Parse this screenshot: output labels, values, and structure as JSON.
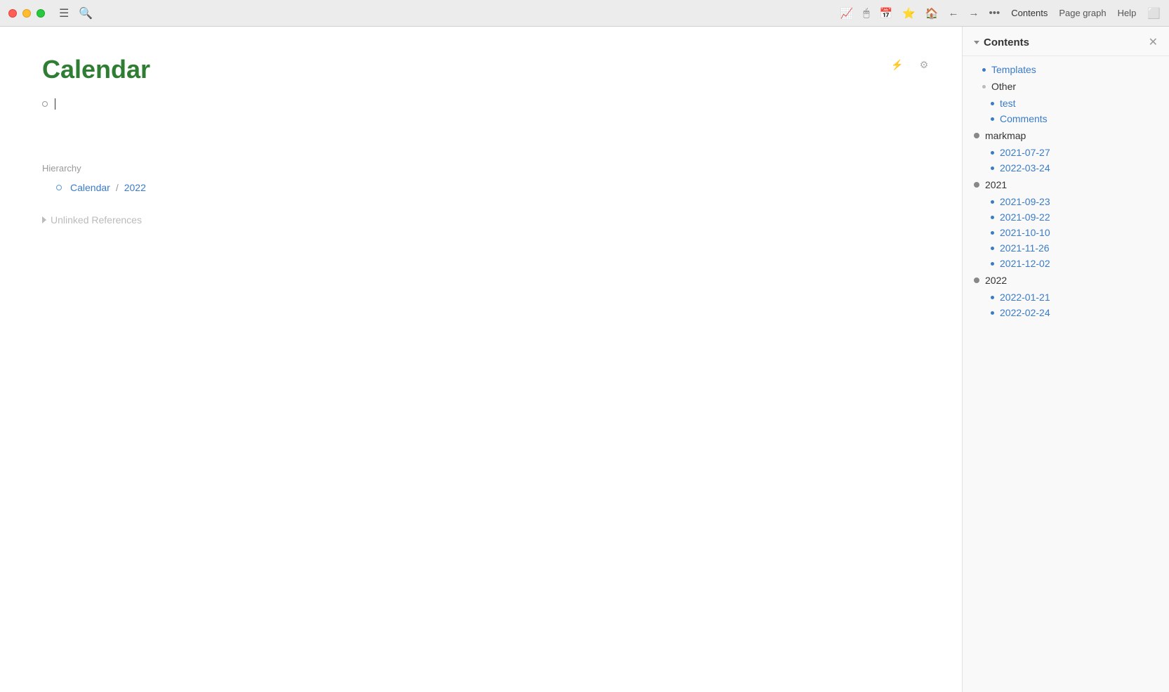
{
  "titlebar": {
    "traffic_lights": [
      "red",
      "yellow",
      "green"
    ],
    "icons": [
      "chart-icon",
      "cursor-icon",
      "calendar-icon",
      "star-icon",
      "home-icon",
      "back-icon",
      "forward-icon",
      "more-icon"
    ],
    "nav_tabs": [
      {
        "label": "Contents",
        "active": true
      },
      {
        "label": "Page graph"
      },
      {
        "label": "Help"
      }
    ],
    "sidebar_toggle": "sidebar-toggle-icon"
  },
  "editor": {
    "page_title": "Calendar",
    "toolbar": {
      "lightning_icon": "⚡",
      "gear_icon": "⚙"
    },
    "bullet_text": "",
    "hierarchy_label": "Hierarchy",
    "hierarchy_items": [
      {
        "text": "Calendar",
        "link": true
      },
      {
        "sep": "/"
      },
      {
        "text": "2022",
        "link": true
      }
    ],
    "unlinked_label": "Unlinked References"
  },
  "panel": {
    "title": "Contents",
    "close_label": "✕",
    "sections": [
      {
        "type": "item",
        "indent": 1,
        "label": "Templates",
        "link": true
      },
      {
        "type": "group",
        "indent": 1,
        "label": "Other",
        "link": false,
        "children": [
          {
            "label": "test",
            "link": true,
            "indent": 2
          },
          {
            "label": "Comments",
            "link": true,
            "indent": 2
          }
        ]
      },
      {
        "type": "group",
        "indent": 0,
        "label": "markmap",
        "link": false,
        "children": [
          {
            "label": "2021-07-27",
            "link": true,
            "indent": 2
          },
          {
            "label": "2022-03-24",
            "link": true,
            "indent": 2
          }
        ]
      },
      {
        "type": "group",
        "indent": 0,
        "label": "2021",
        "link": false,
        "children": [
          {
            "label": "2021-09-23",
            "link": true,
            "indent": 2
          },
          {
            "label": "2021-09-22",
            "link": true,
            "indent": 2
          },
          {
            "label": "2021-10-10",
            "link": true,
            "indent": 2
          },
          {
            "label": "2021-11-26",
            "link": true,
            "indent": 2
          },
          {
            "label": "2021-12-02",
            "link": true,
            "indent": 2
          }
        ]
      },
      {
        "type": "group",
        "indent": 0,
        "label": "2022",
        "link": false,
        "children": [
          {
            "label": "2022-01-21",
            "link": true,
            "indent": 2
          },
          {
            "label": "2022-02-24",
            "link": true,
            "indent": 2
          }
        ]
      }
    ]
  }
}
